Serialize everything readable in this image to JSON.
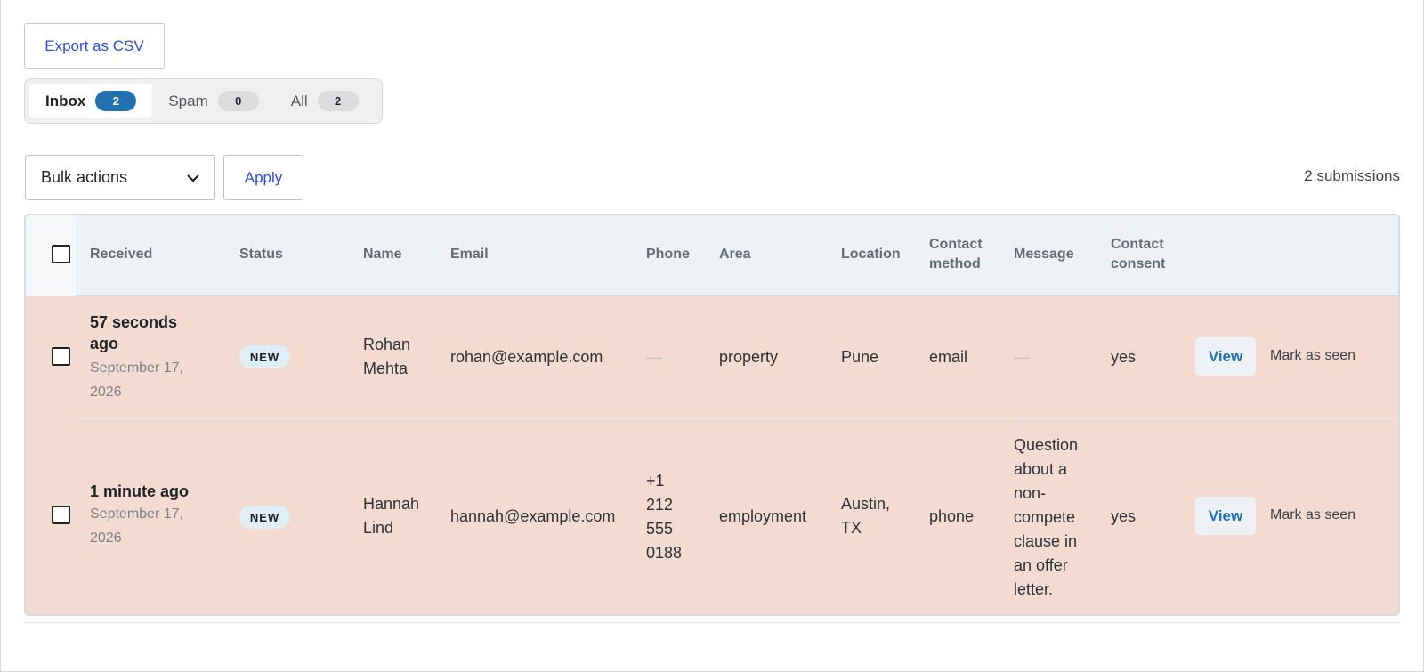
{
  "toolbar": {
    "export_label": "Export as CSV",
    "bulk_actions_label": "Bulk actions",
    "apply_label": "Apply",
    "submission_count": "2 submissions"
  },
  "tabs": [
    {
      "label": "Inbox",
      "count": "2"
    },
    {
      "label": "Spam",
      "count": "0"
    },
    {
      "label": "All",
      "count": "2"
    }
  ],
  "table": {
    "headers": {
      "received": "Received",
      "status": "Status",
      "name": "Name",
      "email": "Email",
      "phone": "Phone",
      "area": "Area",
      "location": "Location",
      "contact_method": "Contact method",
      "message": "Message",
      "contact_consent": "Contact consent"
    },
    "rows": [
      {
        "received": "57 seconds ago",
        "date": "September 17, 2026",
        "status": "NEW",
        "name": "Rohan Mehta",
        "email": "rohan@example.com",
        "phone": "—",
        "area": "property",
        "location": "Pune",
        "contact_method": "email",
        "message": "—",
        "contact_consent": "yes",
        "view_label": "View",
        "mark_seen_label": "Mark as seen"
      },
      {
        "received": "1 minute ago",
        "date": "September 17, 2026",
        "status": "NEW",
        "name": "Hannah Lind",
        "email": "hannah@example.com",
        "phone": "+1 212 555 0188",
        "area": "employment",
        "location": "Austin, TX",
        "contact_method": "phone",
        "message": "Question about a non-compete clause in an offer letter.",
        "contact_consent": "yes",
        "view_label": "View",
        "mark_seen_label": "Mark as seen"
      }
    ]
  },
  "colors": {
    "accent": "#2271b1",
    "link": "#2c4fcf",
    "unread_row": "#f3dbd2",
    "header_bg": "#eef2f7"
  }
}
